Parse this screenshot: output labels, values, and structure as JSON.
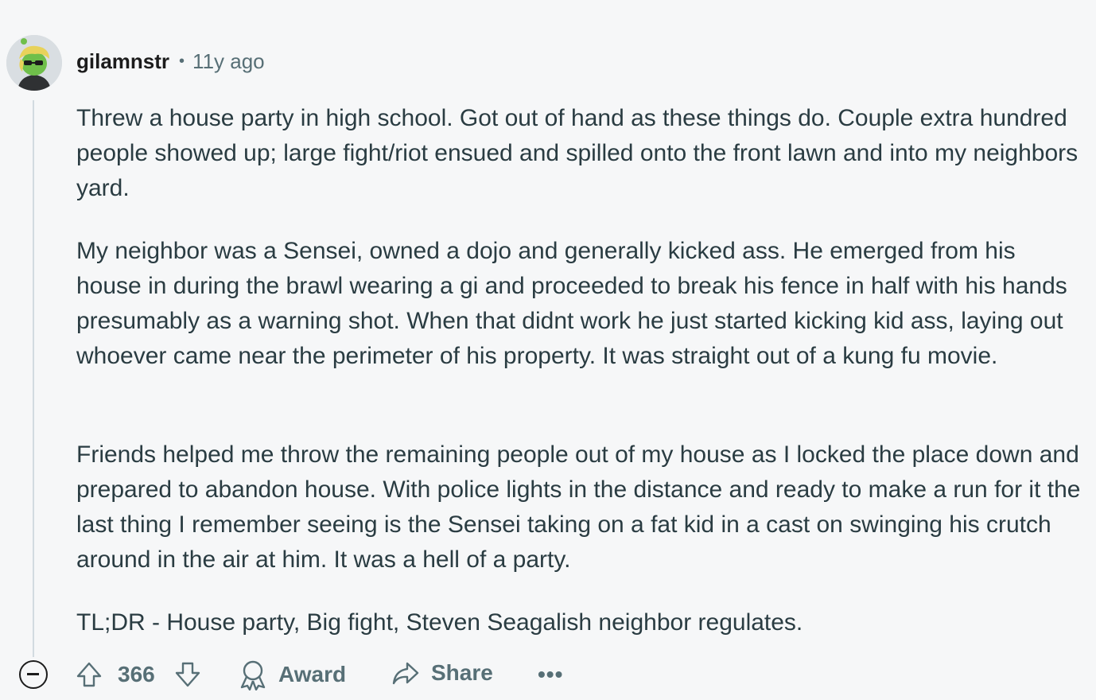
{
  "comment": {
    "author": "gilamnstr",
    "separator": "•",
    "age": "11y ago",
    "paragraphs": [
      "Threw a house party in high school. Got out of hand as these things do. Couple extra hundred people showed up; large fight/riot ensued and spilled onto the front lawn and into my neighbors yard.",
      "My neighbor was a Sensei, owned a dojo and generally kicked ass. He emerged from his house in during the brawl wearing a gi and proceeded to break his fence in half with his hands presumably as a warning shot. When that didnt work he just started kicking kid ass, laying out whoever came near the perimeter of his property. It was straight out of a kung fu movie.",
      "Friends helped me throw the remaining people out of my house as I locked the place down and prepared to abandon house. With police lights in the distance and ready to make a run for it the last thing I remember seeing is the Sensei taking on a fat kid in a cast on swinging his crutch around in the air at him. It was a hell of a party.",
      "TL;DR - House party, Big fight, Steven Seagalish neighbor regulates."
    ]
  },
  "actions": {
    "score": "366",
    "award_label": "Award",
    "share_label": "Share",
    "more_label": "•••"
  },
  "colors": {
    "background": "#f6f7f8",
    "meta_text": "#576f76",
    "body_text": "#2a3c42",
    "thread_line": "#d2dbe0"
  },
  "icons": {
    "avatar": "avatar",
    "collapse": "collapse-icon",
    "upvote": "upvote-icon",
    "downvote": "downvote-icon",
    "award": "award-icon",
    "share": "share-icon",
    "more": "more-options-icon"
  }
}
